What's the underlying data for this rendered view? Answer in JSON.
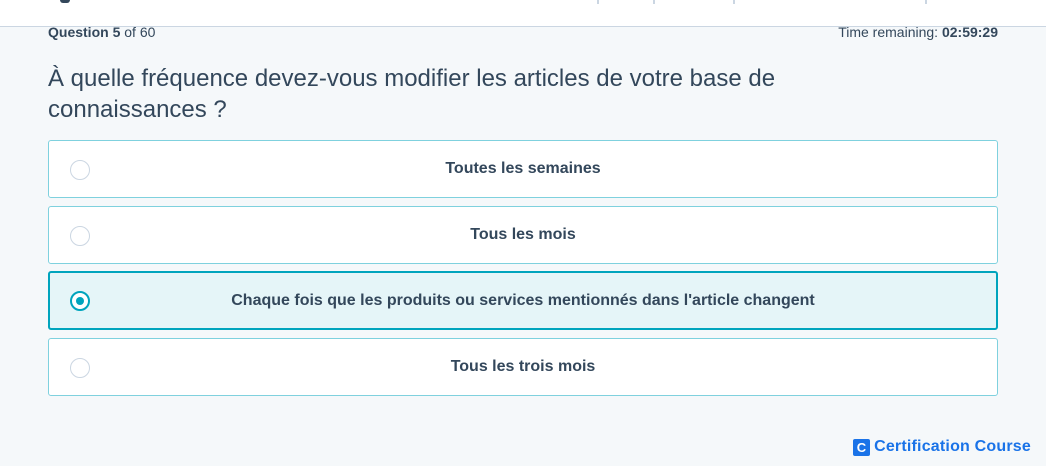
{
  "progress": {
    "question_label": "Question",
    "current": "5",
    "of_label": "of",
    "total": "60"
  },
  "timer": {
    "label": "Time remaining:",
    "value": "02:59:29"
  },
  "question": {
    "text": "À quelle fréquence devez-vous modifier les articles de votre base de connaissances ?"
  },
  "options": [
    {
      "label": "Toutes les semaines",
      "selected": false
    },
    {
      "label": "Tous les mois",
      "selected": false
    },
    {
      "label": "Chaque fois que les produits ou services mentionnés dans l'article changent",
      "selected": true
    },
    {
      "label": "Tous les trois mois",
      "selected": false
    }
  ],
  "brand": {
    "logo_letter": "C",
    "name": "Certification Course"
  },
  "colors": {
    "accent": "#00a4bd",
    "text": "#33475b",
    "border": "#7fd1de",
    "selected_bg": "#e5f5f8",
    "brand": "#1a73e8"
  },
  "icons": {
    "radio": "radio-button-icon",
    "logo": "brand-logo-icon"
  }
}
